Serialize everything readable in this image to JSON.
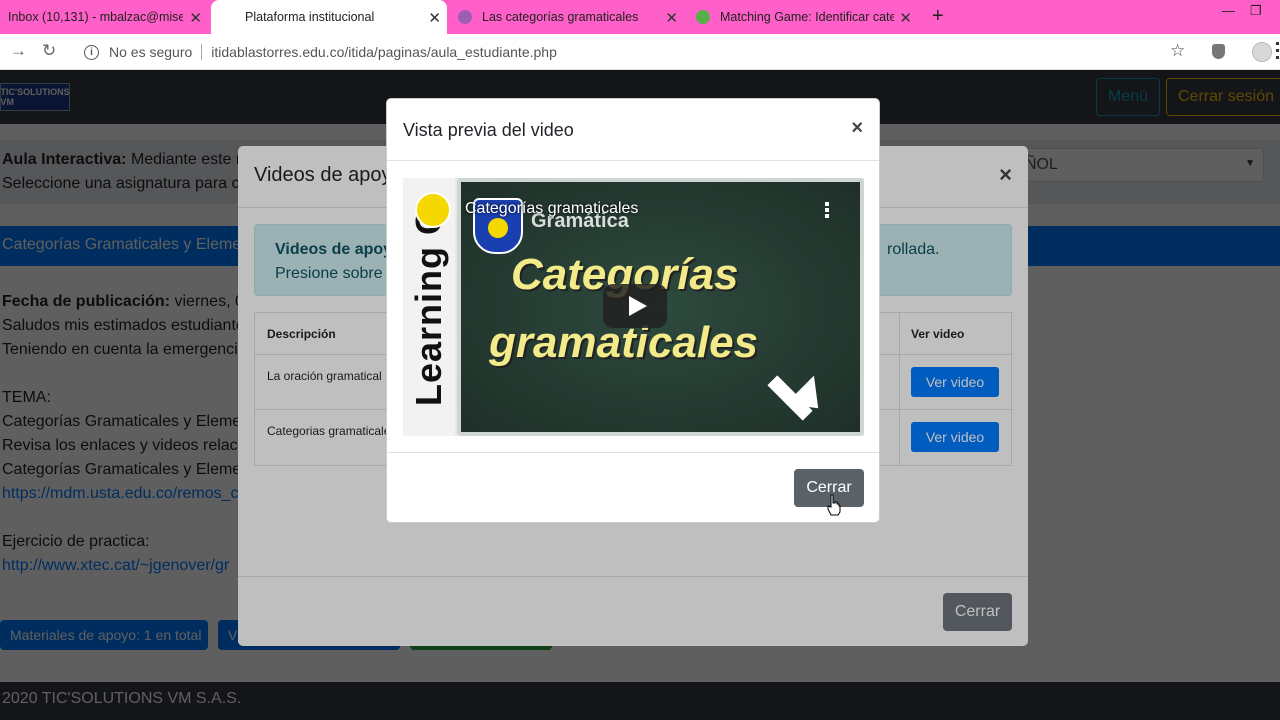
{
  "browser": {
    "tabs": [
      {
        "title": "Inbox (10,131) - mbalzac@misen",
        "active": false
      },
      {
        "title": "Plataforma institucional",
        "active": true
      },
      {
        "title": "Las categorías gramaticales",
        "active": false
      },
      {
        "title": "Matching Game: Identificar categ",
        "active": false
      }
    ],
    "address": {
      "security_label": "No es seguro",
      "url": "itidablastorres.edu.co/itida/paginas/aula_estudiante.php"
    }
  },
  "navbar": {
    "brand": "TIC'SOLUTIONS VM",
    "menu_label": "Menú",
    "logout_label": "Cerrar sesión"
  },
  "aula": {
    "label": "Aula Interactiva:",
    "text1": "Mediante este m",
    "text2": "Seleccione una asignatura para co",
    "subject_selected": "ÑOL"
  },
  "subject_bar": "Categorías Gramaticales y Elemen",
  "post": {
    "date_label": "Fecha de publicación:",
    "date_value": "viernes, 03/",
    "lines": [
      "Saludos mis estimados estudiante",
      "Teniendo en cuenta la emergencia",
      "",
      "TEMA:",
      "Categorías Gramaticales y Elemen",
      "Revisa los enlaces y videos relaci",
      "Categorías Gramaticales y Elemen"
    ],
    "link1": "https://mdm.usta.edu.co/remos_c",
    "exercise_label": "Ejercicio de practica:",
    "link2": "http://www.xtec.cat/~jgenover/gr"
  },
  "pills": {
    "materials": "Materiales de apoyo: 1 en total",
    "videos": "Vi"
  },
  "footer": "2020 TIC'SOLUTIONS VM S.A.S.",
  "modal_videos": {
    "title": "Videos de apoyo",
    "alert_bold": "Videos de apoyo",
    "alert_line2": "Presione sobre e",
    "alert_right": "rollada.",
    "table": {
      "col_desc": "Descripción",
      "col_video": "Ver video",
      "rows": [
        {
          "desc": "La oración gramatical",
          "button": "Ver video"
        },
        {
          "desc": "Categorias gramaticale",
          "button": "Ver video"
        }
      ]
    },
    "close_label": "Cerrar"
  },
  "modal_preview": {
    "title": "Vista previa del video",
    "close_label": "Cerrar",
    "video": {
      "title": "Categorías gramaticales",
      "side_text": "Learning C",
      "sub": "Gramática",
      "big_line1": "Categorías",
      "big_line2": "gramaticales"
    }
  },
  "colors": {
    "tabbar": "#ff5fc8",
    "primary": "#007bff",
    "secondary": "#6c757d",
    "info_bg": "#d1ecf1",
    "navbar": "#343a40"
  }
}
